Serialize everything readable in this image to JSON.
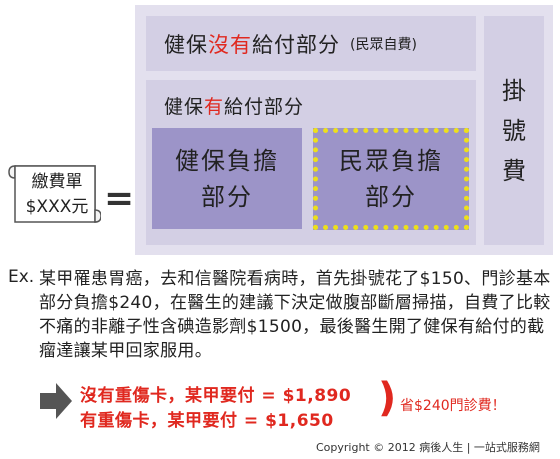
{
  "no_coverage": {
    "prefix": "健保",
    "highlight": "沒有",
    "suffix": "給付部分",
    "sub": "(民眾自費)"
  },
  "coverage": {
    "prefix": "健保",
    "highlight": "有",
    "suffix": "給付部分"
  },
  "health_share": {
    "line1": "健保負擔",
    "line2": "部分"
  },
  "people_share": {
    "line1": "民眾負擔",
    "line2": "部分"
  },
  "registration": "掛號費",
  "bill": {
    "line1": "繳費單",
    "line2": "$XXX元"
  },
  "equals": "=",
  "example": {
    "label": "Ex.",
    "text": "某甲罹患胃癌，去和信醫院看病時，首先掛號花了$150、門診基本部分負擔$240，在醫生的建議下決定做腹部斷層掃描，自費了比較不痛的非離子性含碘造影劑$1500，最後醫生開了健保有給付的截瘤達讓某甲回家服用。"
  },
  "results": {
    "line1": "沒有重傷卡，某甲要付 = $1,890",
    "line2": "有重傷卡，某甲要付 = $1,650",
    "paren": ")",
    "savings": "省$240門診費！"
  },
  "copyright": "Copyright © 2012 病後人生 | 一站式服務網",
  "colors": {
    "accent_red": "#e0281f",
    "purple_dark": "#9c94c8",
    "purple_light": "#d3cfe4",
    "dotted_yellow": "#ecdf1c"
  }
}
